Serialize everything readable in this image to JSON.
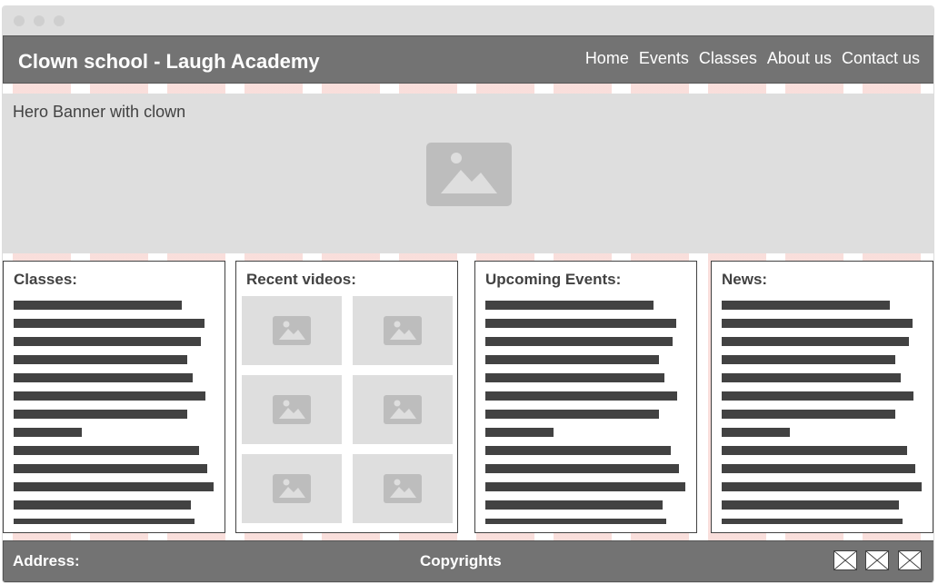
{
  "header": {
    "site_title": "Clown school - Laugh Academy",
    "nav": [
      "Home",
      "Events",
      "Classes",
      "About us",
      "Contact us"
    ]
  },
  "hero": {
    "label": "Hero Banner with clown",
    "icon": "image-placeholder-icon"
  },
  "panels": {
    "classes": {
      "title": "Classes:"
    },
    "videos": {
      "title": "Recent videos:",
      "thumbnail_count": 6
    },
    "events": {
      "title": "Upcoming Events:"
    },
    "news": {
      "title": "News:"
    }
  },
  "footer": {
    "address_label": "Address:",
    "copyrights_label": "Copyrights",
    "social_icons": [
      "social-link-1",
      "social-link-2",
      "social-link-3"
    ]
  },
  "colors": {
    "header_bg": "#737373",
    "hero_bg": "#dedede",
    "text_dark": "#424242",
    "grid_overlay": "#f4c4be"
  }
}
